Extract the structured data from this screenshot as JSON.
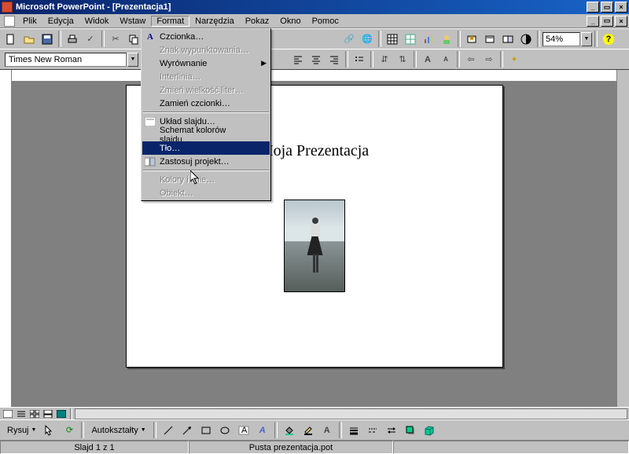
{
  "title": "Microsoft PowerPoint - [Prezentacja1]",
  "menubar": [
    "Plik",
    "Edycja",
    "Widok",
    "Wstaw",
    "Format",
    "Narzędzia",
    "Pokaz",
    "Okno",
    "Pomoc"
  ],
  "open_menu_index": 4,
  "format_menu": {
    "czcionka": "Czcionka…",
    "znak_wypunkt": "Znak wypunktowania…",
    "wyrownanie": "Wyrównanie",
    "interlinia": "Interlinia…",
    "zmien_wielkosc": "Zmień wielkość liter…",
    "zamien_czcionki": "Zamień czcionki…",
    "uklad_slajdu": "Układ slajdu…",
    "schemat_kolorow": "Schemat kolorów slajdu…",
    "tlo": "Tło…",
    "zastosuj_projekt": "Zastosuj projekt…",
    "kolory_linie": "Kolory i linie…",
    "obiekt": "Obiekt…"
  },
  "font_name": "Times New Roman",
  "zoom": "54%",
  "slide_title": "Moja Prezentacja",
  "draw": {
    "rysuj": "Rysuj",
    "autoksztalty": "Autokształty"
  },
  "status": {
    "slide": "Slajd 1 z 1",
    "template": "Pusta prezentacja.pot"
  }
}
